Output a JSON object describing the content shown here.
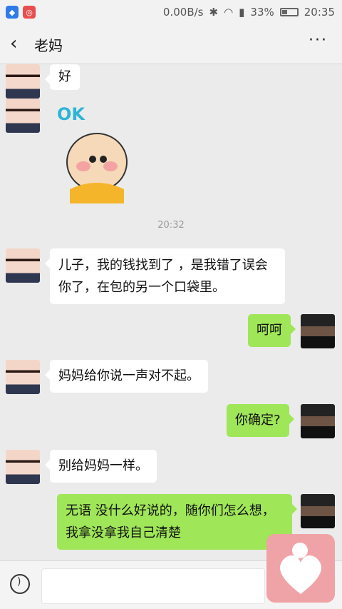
{
  "status": {
    "speed": "0.00B/s",
    "battery": "33%",
    "time": "20:35",
    "battery_level": 0.33
  },
  "header": {
    "title": "老妈",
    "back_icon": "chevron-left-icon",
    "more": "···"
  },
  "chat": {
    "time": "20:32",
    "messages": [
      {
        "side": "left",
        "text": "好"
      },
      {
        "side": "left",
        "sticker": "OK"
      },
      {
        "side": "left",
        "text": "儿子，我的钱找到了 ，是我错了误会你了，在包的另一个口袋里。"
      },
      {
        "side": "right",
        "text": "呵呵"
      },
      {
        "side": "left",
        "text": "妈妈给你说一声对不起。"
      },
      {
        "side": "right",
        "text": "你确定?"
      },
      {
        "side": "left",
        "text": "别给妈妈一样。"
      },
      {
        "side": "right",
        "text": "无语 没什么好说的，随你们怎么想，我拿没拿我自己清楚"
      }
    ]
  },
  "input": {
    "placeholder": ""
  }
}
